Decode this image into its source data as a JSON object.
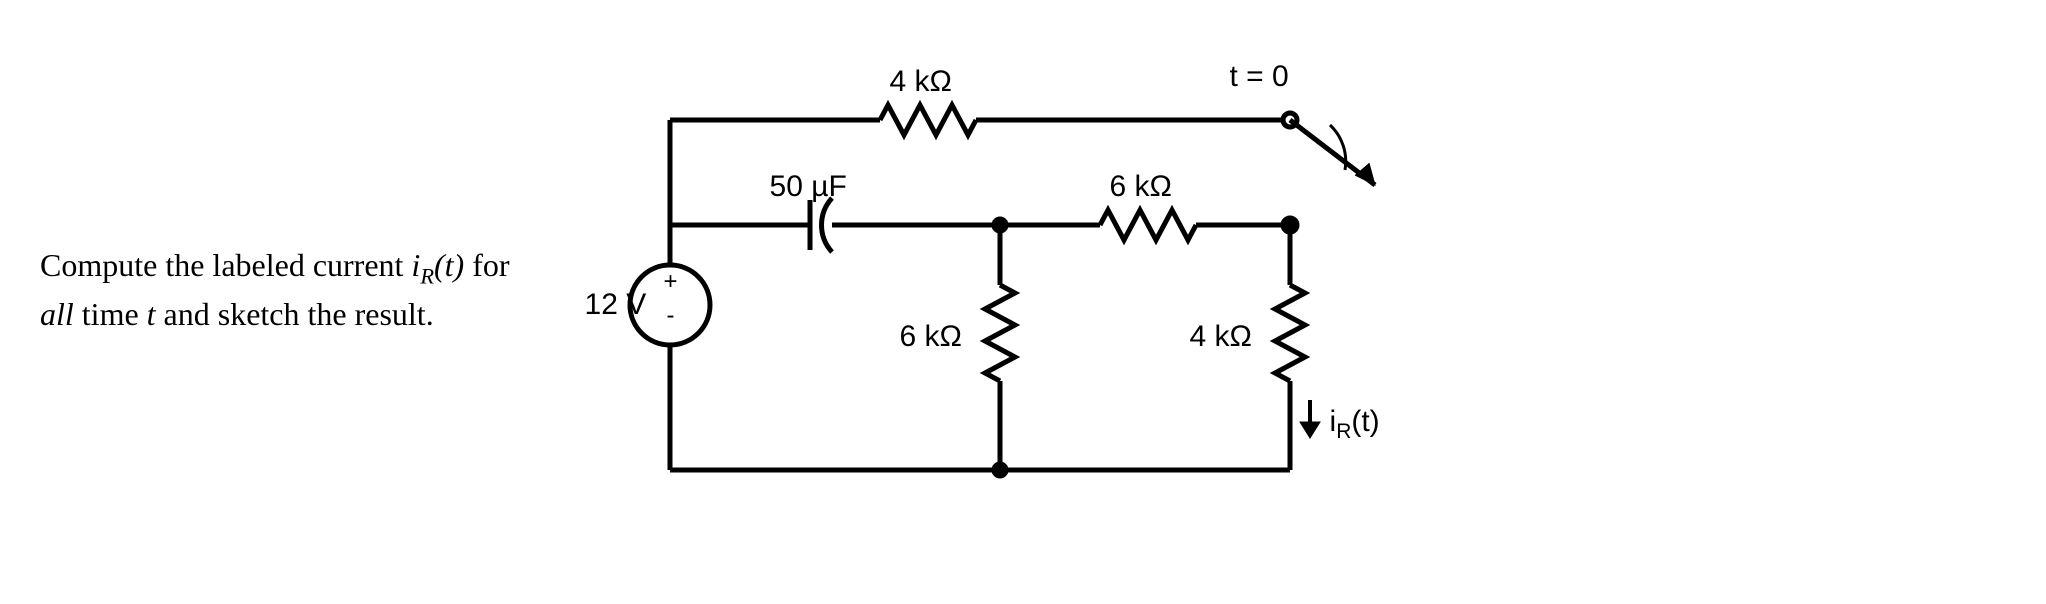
{
  "problem": {
    "text_prefix": "Compute the labeled current ",
    "current_var": "i",
    "current_sub": "R",
    "current_arg": "(t)",
    "text_mid": " for",
    "all_italic": "all",
    "text_suffix": " time ",
    "time_var": "t",
    "text_end": " and sketch the result."
  },
  "circuit": {
    "source_label": "12 V",
    "source_pos": "+",
    "source_neg": "-",
    "r_top": "4 kΩ",
    "switch_label": "t = 0",
    "capacitor": "50 µF",
    "r_right_upper": "6 kΩ",
    "r_left_lower": "6 kΩ",
    "r_right_lower": "4 kΩ",
    "current_label_prefix": "i",
    "current_label_sub": "R",
    "current_label_arg": "(t)"
  },
  "chart_data": {
    "type": "circuit-diagram",
    "description": "RC circuit with switch closing at t=0",
    "source": {
      "type": "DC voltage",
      "value": 12,
      "unit": "V"
    },
    "components": [
      {
        "name": "R_top",
        "type": "resistor",
        "value": 4,
        "unit": "kΩ",
        "location": "top branch"
      },
      {
        "name": "C",
        "type": "capacitor",
        "value": 50,
        "unit": "µF",
        "location": "middle-left branch"
      },
      {
        "name": "R_6k_upper",
        "type": "resistor",
        "value": 6,
        "unit": "kΩ",
        "location": "middle-right branch"
      },
      {
        "name": "R_6k_lower",
        "type": "resistor",
        "value": 6,
        "unit": "kΩ",
        "location": "vertical middle"
      },
      {
        "name": "R_4k_lower",
        "type": "resistor",
        "value": 4,
        "unit": "kΩ",
        "location": "vertical right, carries i_R(t)"
      },
      {
        "name": "SW",
        "type": "switch",
        "action": "closes",
        "time": 0,
        "location": "top-right"
      }
    ],
    "measured_current": "i_R(t) through 4 kΩ rightmost resistor (downward)"
  }
}
